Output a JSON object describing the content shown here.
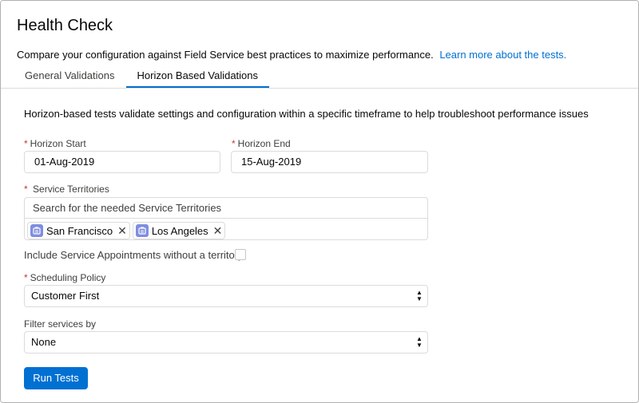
{
  "header": {
    "title": "Health Check",
    "description": "Compare your configuration against Field Service best practices to maximize performance.",
    "learn_more_link": "Learn more about the tests."
  },
  "tabs": [
    {
      "label": "General Validations",
      "active": false
    },
    {
      "label": "Horizon Based Validations",
      "active": true
    }
  ],
  "content": {
    "intro": "Horizon-based tests validate settings and configuration within a specific timeframe to help troubleshoot performance issues",
    "horizon_start": {
      "label": "Horizon Start",
      "required_mark": "*",
      "value": "01-Aug-2019"
    },
    "horizon_end": {
      "label": "Horizon End",
      "required_mark": "*",
      "value": "15-Aug-2019"
    },
    "service_territories": {
      "label": "Service Territories",
      "required_mark": "*",
      "placeholder": "Search for the needed Service Territories",
      "selected": [
        "San Francisco",
        "Los Angeles"
      ]
    },
    "include_without_territory": {
      "label": "Include Service Appointments without a territory",
      "checked": false
    },
    "scheduling_policy": {
      "label": "Scheduling Policy",
      "required_mark": "*",
      "value": "Customer First"
    },
    "filter_services": {
      "label": "Filter services by",
      "value": "None"
    },
    "run_button": "Run Tests"
  },
  "colors": {
    "brand": "#0070d2",
    "required": "#c23934",
    "pill_icon": "#7f8de1",
    "border": "#dddbda"
  },
  "icons": {
    "pill": "service-territory-icon",
    "remove": "close-icon",
    "select": "up-down-arrows-icon"
  }
}
